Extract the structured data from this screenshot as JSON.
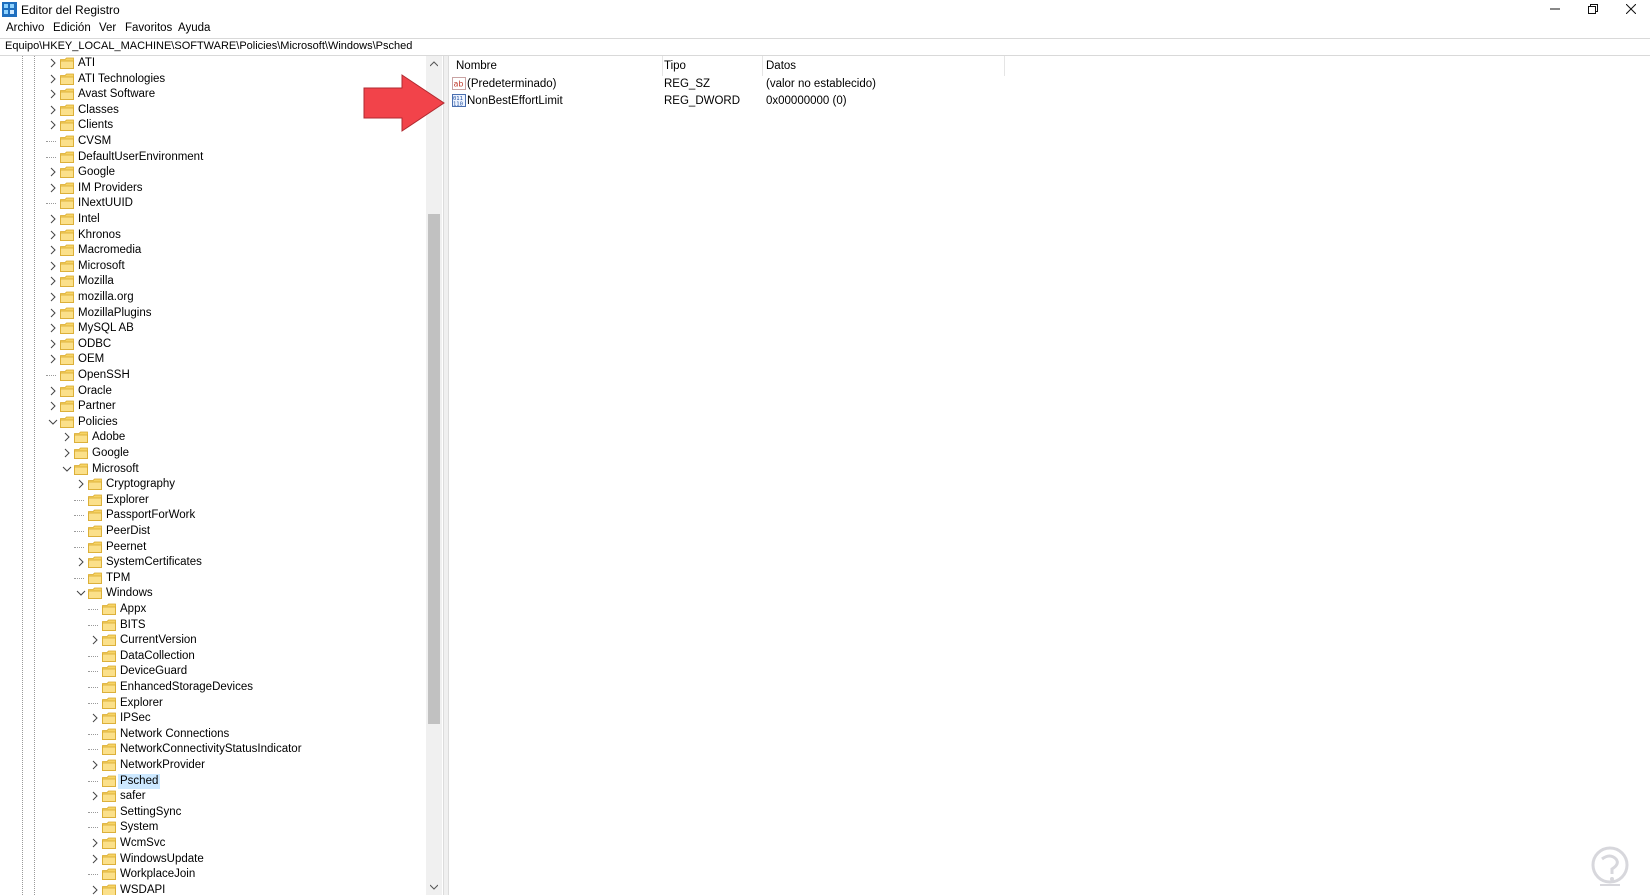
{
  "window": {
    "title": "Editor del Registro",
    "controls": {
      "minimize": "—",
      "restore": "❐",
      "close": "✕"
    }
  },
  "menu": {
    "items": [
      "Archivo",
      "Edición",
      "Ver",
      "Favoritos",
      "Ayuda"
    ]
  },
  "address": {
    "path": "Equipo\\HKEY_LOCAL_MACHINE\\SOFTWARE\\Policies\\Microsoft\\Windows\\Psched"
  },
  "tree": {
    "nodes": [
      {
        "label": "ATI",
        "depth": 0,
        "expander": "collapsed"
      },
      {
        "label": "ATI Technologies",
        "depth": 0,
        "expander": "collapsed"
      },
      {
        "label": "Avast Software",
        "depth": 0,
        "expander": "collapsed"
      },
      {
        "label": "Classes",
        "depth": 0,
        "expander": "collapsed"
      },
      {
        "label": "Clients",
        "depth": 0,
        "expander": "collapsed"
      },
      {
        "label": "CVSM",
        "depth": 0,
        "expander": "none"
      },
      {
        "label": "DefaultUserEnvironment",
        "depth": 0,
        "expander": "none"
      },
      {
        "label": "Google",
        "depth": 0,
        "expander": "collapsed"
      },
      {
        "label": "IM Providers",
        "depth": 0,
        "expander": "collapsed"
      },
      {
        "label": "INextUUID",
        "depth": 0,
        "expander": "none"
      },
      {
        "label": "Intel",
        "depth": 0,
        "expander": "collapsed"
      },
      {
        "label": "Khronos",
        "depth": 0,
        "expander": "collapsed"
      },
      {
        "label": "Macromedia",
        "depth": 0,
        "expander": "collapsed"
      },
      {
        "label": "Microsoft",
        "depth": 0,
        "expander": "collapsed"
      },
      {
        "label": "Mozilla",
        "depth": 0,
        "expander": "collapsed"
      },
      {
        "label": "mozilla.org",
        "depth": 0,
        "expander": "collapsed"
      },
      {
        "label": "MozillaPlugins",
        "depth": 0,
        "expander": "collapsed"
      },
      {
        "label": "MySQL AB",
        "depth": 0,
        "expander": "collapsed"
      },
      {
        "label": "ODBC",
        "depth": 0,
        "expander": "collapsed"
      },
      {
        "label": "OEM",
        "depth": 0,
        "expander": "collapsed"
      },
      {
        "label": "OpenSSH",
        "depth": 0,
        "expander": "none"
      },
      {
        "label": "Oracle",
        "depth": 0,
        "expander": "collapsed"
      },
      {
        "label": "Partner",
        "depth": 0,
        "expander": "collapsed"
      },
      {
        "label": "Policies",
        "depth": 0,
        "expander": "expanded"
      },
      {
        "label": "Adobe",
        "depth": 1,
        "expander": "collapsed"
      },
      {
        "label": "Google",
        "depth": 1,
        "expander": "collapsed"
      },
      {
        "label": "Microsoft",
        "depth": 1,
        "expander": "expanded"
      },
      {
        "label": "Cryptography",
        "depth": 2,
        "expander": "collapsed"
      },
      {
        "label": "Explorer",
        "depth": 2,
        "expander": "none"
      },
      {
        "label": "PassportForWork",
        "depth": 2,
        "expander": "none"
      },
      {
        "label": "PeerDist",
        "depth": 2,
        "expander": "none"
      },
      {
        "label": "Peernet",
        "depth": 2,
        "expander": "none"
      },
      {
        "label": "SystemCertificates",
        "depth": 2,
        "expander": "collapsed"
      },
      {
        "label": "TPM",
        "depth": 2,
        "expander": "none"
      },
      {
        "label": "Windows",
        "depth": 2,
        "expander": "expanded"
      },
      {
        "label": "Appx",
        "depth": 3,
        "expander": "none"
      },
      {
        "label": "BITS",
        "depth": 3,
        "expander": "none"
      },
      {
        "label": "CurrentVersion",
        "depth": 3,
        "expander": "collapsed"
      },
      {
        "label": "DataCollection",
        "depth": 3,
        "expander": "none"
      },
      {
        "label": "DeviceGuard",
        "depth": 3,
        "expander": "none"
      },
      {
        "label": "EnhancedStorageDevices",
        "depth": 3,
        "expander": "none"
      },
      {
        "label": "Explorer",
        "depth": 3,
        "expander": "none"
      },
      {
        "label": "IPSec",
        "depth": 3,
        "expander": "collapsed"
      },
      {
        "label": "Network Connections",
        "depth": 3,
        "expander": "none"
      },
      {
        "label": "NetworkConnectivityStatusIndicator",
        "depth": 3,
        "expander": "none"
      },
      {
        "label": "NetworkProvider",
        "depth": 3,
        "expander": "collapsed"
      },
      {
        "label": "Psched",
        "depth": 3,
        "expander": "none",
        "selected": true
      },
      {
        "label": "safer",
        "depth": 3,
        "expander": "collapsed"
      },
      {
        "label": "SettingSync",
        "depth": 3,
        "expander": "none"
      },
      {
        "label": "System",
        "depth": 3,
        "expander": "none"
      },
      {
        "label": "WcmSvc",
        "depth": 3,
        "expander": "collapsed"
      },
      {
        "label": "WindowsUpdate",
        "depth": 3,
        "expander": "collapsed"
      },
      {
        "label": "WorkplaceJoin",
        "depth": 3,
        "expander": "none"
      },
      {
        "label": "WSDAPI",
        "depth": 3,
        "expander": "collapsed"
      }
    ]
  },
  "values": {
    "columns": [
      "Nombre",
      "Tipo",
      "Datos"
    ],
    "rows": [
      {
        "icon": "string-value-icon",
        "name": "(Predeterminado)",
        "type": "REG_SZ",
        "data": "(valor no establecido)"
      },
      {
        "icon": "binary-value-icon",
        "name": "NonBestEffortLimit",
        "type": "REG_DWORD",
        "data": "0x00000000 (0)"
      }
    ]
  },
  "colors": {
    "selection": "#cce8ff",
    "folder": "#f6d365",
    "annotation_arrow": "#f2434a",
    "logo": "#d7d7dc"
  },
  "icons": {
    "app": "registry-editor-icon",
    "expander_collapsed": "chevron-right-icon",
    "expander_expanded": "chevron-down-icon",
    "folder": "folder-icon",
    "annotation": "red-arrow-icon",
    "watermark": "logo-icon"
  }
}
